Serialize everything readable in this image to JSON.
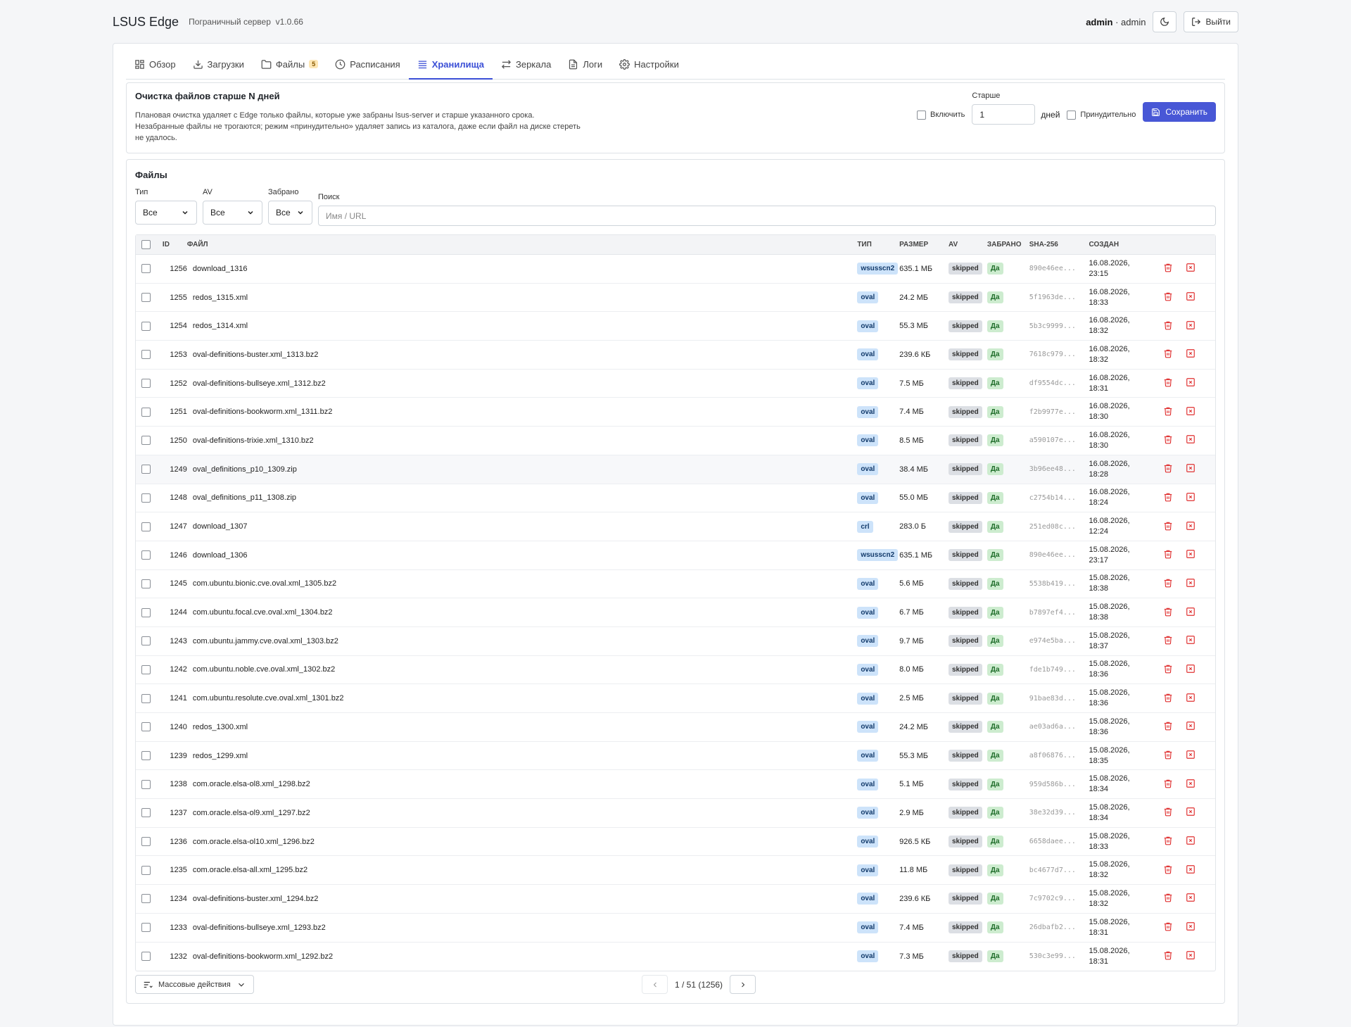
{
  "header": {
    "title": "LSUS Edge",
    "subtitle": "Пограничный сервер",
    "version": "v1.0.66",
    "user_name": "admin",
    "user_sep": " · ",
    "user_role": "admin",
    "theme_icon": "moon-icon",
    "logout_label": "Выйти"
  },
  "tabs": [
    {
      "label": "Обзор",
      "icon": "grid-icon"
    },
    {
      "label": "Загрузки",
      "icon": "download-icon"
    },
    {
      "label": "Файлы",
      "icon": "folder-icon",
      "badge": "5"
    },
    {
      "label": "Расписания",
      "icon": "clock-icon"
    },
    {
      "label": "Хранилища",
      "icon": "storage-icon",
      "active": true
    },
    {
      "label": "Зеркала",
      "icon": "swap-icon"
    },
    {
      "label": "Логи",
      "icon": "file-icon"
    },
    {
      "label": "Настройки",
      "icon": "gear-icon"
    }
  ],
  "cleanup": {
    "title": "Очистка файлов старше N дней",
    "description": "Плановая очистка удаляет с Edge только файлы, которые уже забраны lsus-server и старше указанного срока. Незабранные файлы не трогаются; режим «принудительно» удаляет запись из каталога, даже если файл на диске стереть не удалось.",
    "enable_label": "Включить",
    "older_label": "Старше",
    "older_value": "1",
    "days_label": "дней",
    "force_label": "Принудительно",
    "save_label": "Сохранить"
  },
  "files": {
    "title": "Файлы",
    "filters": {
      "type_label": "Тип",
      "type_value": "Все",
      "av_label": "AV",
      "av_value": "Все",
      "taken_label": "Забрано",
      "taken_value": "Все",
      "search_label": "Поиск",
      "search_placeholder": "Имя / URL"
    },
    "columns": {
      "id": "ID",
      "file": "ФАЙЛ",
      "type": "ТИП",
      "size": "РАЗМЕР",
      "av": "AV",
      "taken": "ЗАБРАНО",
      "sha": "SHA-256",
      "created": "СОЗДАН"
    },
    "rows": [
      {
        "id": "1256",
        "file": "download_1316",
        "type": "wsusscn2",
        "size": "635.1 МБ",
        "av": "skipped",
        "taken": "Да",
        "sha": "890e46ee...",
        "date": "16.08.2026,",
        "time": "23:15"
      },
      {
        "id": "1255",
        "file": "redos_1315.xml",
        "type": "oval",
        "size": "24.2 МБ",
        "av": "skipped",
        "taken": "Да",
        "sha": "5f1963de...",
        "date": "16.08.2026,",
        "time": "18:33"
      },
      {
        "id": "1254",
        "file": "redos_1314.xml",
        "type": "oval",
        "size": "55.3 МБ",
        "av": "skipped",
        "taken": "Да",
        "sha": "5b3c9999...",
        "date": "16.08.2026,",
        "time": "18:32"
      },
      {
        "id": "1253",
        "file": "oval-definitions-buster.xml_1313.bz2",
        "type": "oval",
        "size": "239.6 КБ",
        "av": "skipped",
        "taken": "Да",
        "sha": "7618c979...",
        "date": "16.08.2026,",
        "time": "18:32"
      },
      {
        "id": "1252",
        "file": "oval-definitions-bullseye.xml_1312.bz2",
        "type": "oval",
        "size": "7.5 МБ",
        "av": "skipped",
        "taken": "Да",
        "sha": "df9554dc...",
        "date": "16.08.2026,",
        "time": "18:31"
      },
      {
        "id": "1251",
        "file": "oval-definitions-bookworm.xml_1311.bz2",
        "type": "oval",
        "size": "7.4 МБ",
        "av": "skipped",
        "taken": "Да",
        "sha": "f2b9977e...",
        "date": "16.08.2026,",
        "time": "18:30"
      },
      {
        "id": "1250",
        "file": "oval-definitions-trixie.xml_1310.bz2",
        "type": "oval",
        "size": "8.5 МБ",
        "av": "skipped",
        "taken": "Да",
        "sha": "a590107e...",
        "date": "16.08.2026,",
        "time": "18:30"
      },
      {
        "id": "1249",
        "file": "oval_definitions_p10_1309.zip",
        "type": "oval",
        "size": "38.4 МБ",
        "av": "skipped",
        "taken": "Да",
        "sha": "3b96ee48...",
        "date": "16.08.2026,",
        "time": "18:28"
      },
      {
        "id": "1248",
        "file": "oval_definitions_p11_1308.zip",
        "type": "oval",
        "size": "55.0 МБ",
        "av": "skipped",
        "taken": "Да",
        "sha": "c2754b14...",
        "date": "16.08.2026,",
        "time": "18:24"
      },
      {
        "id": "1247",
        "file": "download_1307",
        "type": "crl",
        "size": "283.0 Б",
        "av": "skipped",
        "taken": "Да",
        "sha": "251ed08c...",
        "date": "16.08.2026,",
        "time": "12:24"
      },
      {
        "id": "1246",
        "file": "download_1306",
        "type": "wsusscn2",
        "size": "635.1 МБ",
        "av": "skipped",
        "taken": "Да",
        "sha": "890e46ee...",
        "date": "15.08.2026,",
        "time": "23:17"
      },
      {
        "id": "1245",
        "file": "com.ubuntu.bionic.cve.oval.xml_1305.bz2",
        "type": "oval",
        "size": "5.6 МБ",
        "av": "skipped",
        "taken": "Да",
        "sha": "5538b419...",
        "date": "15.08.2026,",
        "time": "18:38"
      },
      {
        "id": "1244",
        "file": "com.ubuntu.focal.cve.oval.xml_1304.bz2",
        "type": "oval",
        "size": "6.7 МБ",
        "av": "skipped",
        "taken": "Да",
        "sha": "b7897ef4...",
        "date": "15.08.2026,",
        "time": "18:38"
      },
      {
        "id": "1243",
        "file": "com.ubuntu.jammy.cve.oval.xml_1303.bz2",
        "type": "oval",
        "size": "9.7 МБ",
        "av": "skipped",
        "taken": "Да",
        "sha": "e974e5ba...",
        "date": "15.08.2026,",
        "time": "18:37"
      },
      {
        "id": "1242",
        "file": "com.ubuntu.noble.cve.oval.xml_1302.bz2",
        "type": "oval",
        "size": "8.0 МБ",
        "av": "skipped",
        "taken": "Да",
        "sha": "fde1b749...",
        "date": "15.08.2026,",
        "time": "18:36"
      },
      {
        "id": "1241",
        "file": "com.ubuntu.resolute.cve.oval.xml_1301.bz2",
        "type": "oval",
        "size": "2.5 МБ",
        "av": "skipped",
        "taken": "Да",
        "sha": "91bae83d...",
        "date": "15.08.2026,",
        "time": "18:36"
      },
      {
        "id": "1240",
        "file": "redos_1300.xml",
        "type": "oval",
        "size": "24.2 МБ",
        "av": "skipped",
        "taken": "Да",
        "sha": "ae03ad6a...",
        "date": "15.08.2026,",
        "time": "18:36"
      },
      {
        "id": "1239",
        "file": "redos_1299.xml",
        "type": "oval",
        "size": "55.3 МБ",
        "av": "skipped",
        "taken": "Да",
        "sha": "a8f06876...",
        "date": "15.08.2026,",
        "time": "18:35"
      },
      {
        "id": "1238",
        "file": "com.oracle.elsa-ol8.xml_1298.bz2",
        "type": "oval",
        "size": "5.1 МБ",
        "av": "skipped",
        "taken": "Да",
        "sha": "959d586b...",
        "date": "15.08.2026,",
        "time": "18:34"
      },
      {
        "id": "1237",
        "file": "com.oracle.elsa-ol9.xml_1297.bz2",
        "type": "oval",
        "size": "2.9 МБ",
        "av": "skipped",
        "taken": "Да",
        "sha": "38e32d39...",
        "date": "15.08.2026,",
        "time": "18:34"
      },
      {
        "id": "1236",
        "file": "com.oracle.elsa-ol10.xml_1296.bz2",
        "type": "oval",
        "size": "926.5 КБ",
        "av": "skipped",
        "taken": "Да",
        "sha": "6658daee...",
        "date": "15.08.2026,",
        "time": "18:33"
      },
      {
        "id": "1235",
        "file": "com.oracle.elsa-all.xml_1295.bz2",
        "type": "oval",
        "size": "11.8 МБ",
        "av": "skipped",
        "taken": "Да",
        "sha": "bc4677d7...",
        "date": "15.08.2026,",
        "time": "18:32"
      },
      {
        "id": "1234",
        "file": "oval-definitions-buster.xml_1294.bz2",
        "type": "oval",
        "size": "239.6 КБ",
        "av": "skipped",
        "taken": "Да",
        "sha": "7c9702c9...",
        "date": "15.08.2026,",
        "time": "18:32"
      },
      {
        "id": "1233",
        "file": "oval-definitions-bullseye.xml_1293.bz2",
        "type": "oval",
        "size": "7.4 МБ",
        "av": "skipped",
        "taken": "Да",
        "sha": "26dbafb2...",
        "date": "15.08.2026,",
        "time": "18:31"
      },
      {
        "id": "1232",
        "file": "oval-definitions-bookworm.xml_1292.bz2",
        "type": "oval",
        "size": "7.3 МБ",
        "av": "skipped",
        "taken": "Да",
        "sha": "530c3e99...",
        "date": "15.08.2026,",
        "time": "18:31"
      }
    ],
    "bulk_label": "Массовые действия",
    "pagination": "1 / 51 (1256)"
  },
  "colors": {
    "accent": "#4857d6",
    "danger": "#e03131",
    "type_tag": "#cde3fa",
    "yes_tag": "#cdeccf"
  }
}
